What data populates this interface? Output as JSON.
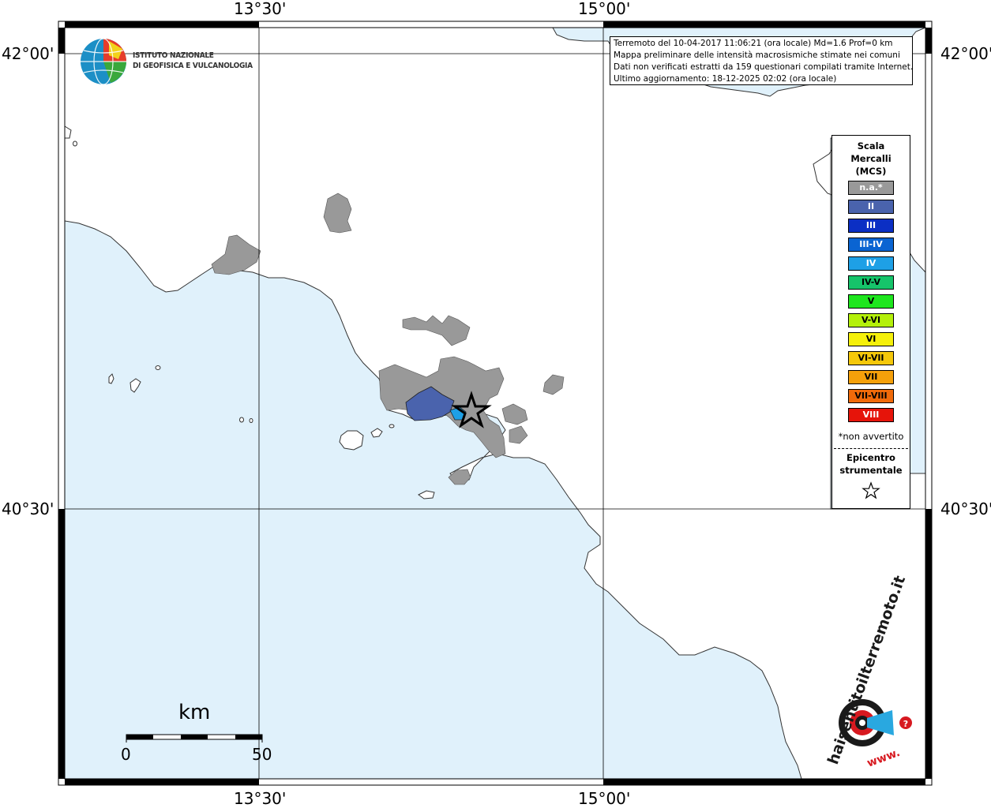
{
  "map": {
    "lon_labels": [
      "13°30'",
      "15°00'"
    ],
    "lat_labels": [
      "42°00'",
      "40°30'"
    ],
    "land_color": "#ffffff",
    "sea_color": "#e0f1fb",
    "region_color_na": "#999999",
    "region_color_ii": "#4a63ad",
    "region_color_iv": "#1ea0e6",
    "epicenter": "star-icon"
  },
  "info": {
    "line1": "Terremoto del 10-04-2017 11:06:21 (ora locale) Md=1.6 Prof=0 km",
    "line2": "Mappa preliminare delle intensità macrosismiche stimate nei comuni",
    "line3": "Dati non verificati estratti da 159 questionari compilati tramite Internet.",
    "line4": "Ultimo aggiornamento: 18-12-2025 02:02 (ora locale)"
  },
  "logo": {
    "line1": "ISTITUTO NAZIONALE",
    "line2": "DI GEOFISICA E VULCANOLOGIA"
  },
  "legend": {
    "title1": "Scala",
    "title2": "Mercalli",
    "title3": "(MCS)",
    "items": [
      {
        "label": "n.a.*",
        "color": "#999999",
        "text": "#ffffff"
      },
      {
        "label": "II",
        "color": "#4a63ad",
        "text": "#ffffff"
      },
      {
        "label": "III",
        "color": "#0b2fc4",
        "text": "#ffffff"
      },
      {
        "label": "III-IV",
        "color": "#0a64d2",
        "text": "#ffffff"
      },
      {
        "label": "IV",
        "color": "#1ea0e6",
        "text": "#ffffff"
      },
      {
        "label": "IV-V",
        "color": "#16c46a",
        "text": "#000000"
      },
      {
        "label": "V",
        "color": "#1ee61e",
        "text": "#000000"
      },
      {
        "label": "V-VI",
        "color": "#b4f00a",
        "text": "#000000"
      },
      {
        "label": "VI",
        "color": "#f5f00a",
        "text": "#000000"
      },
      {
        "label": "VI-VII",
        "color": "#f5c80a",
        "text": "#000000"
      },
      {
        "label": "VII",
        "color": "#f5a00a",
        "text": "#000000"
      },
      {
        "label": "VII-VIII",
        "color": "#f06a0a",
        "text": "#000000"
      },
      {
        "label": "VIII",
        "color": "#e6140a",
        "text": "#ffffff"
      }
    ],
    "note": "*non avvertito",
    "epi1": "Epicentro",
    "epi2": "strumentale"
  },
  "scalebar": {
    "unit": "km",
    "start": "0",
    "end": "50"
  },
  "site_logo": {
    "text": "haisentitoilterremoto.it",
    "prefix": "www."
  }
}
